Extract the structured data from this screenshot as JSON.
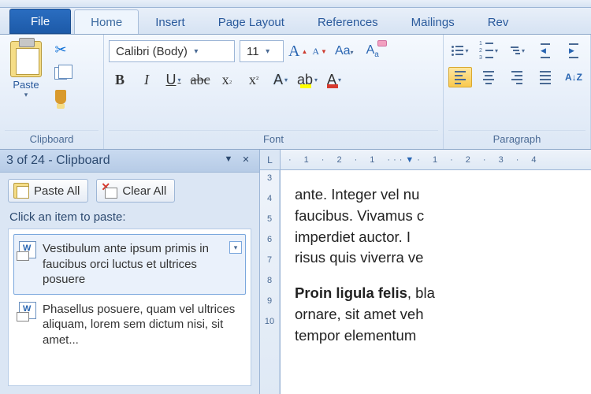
{
  "tabs": {
    "file": "File",
    "home": "Home",
    "insert": "Insert",
    "page_layout": "Page Layout",
    "references": "References",
    "mailings": "Mailings",
    "review": "Rev"
  },
  "ribbon": {
    "clipboard": {
      "label": "Clipboard",
      "paste": "Paste"
    },
    "font": {
      "label": "Font",
      "name": "Calibri (Body)",
      "size": "11",
      "bold": "B",
      "italic": "I",
      "underline": "U",
      "strike": "abc",
      "sub": "x",
      "sup": "x",
      "texteffect": "A",
      "highlight": "ab",
      "fontcolor": "A",
      "grow": "A",
      "shrink": "A",
      "case": "Aa",
      "clear": "A"
    },
    "paragraph": {
      "label": "Paragraph",
      "sort": "A↓Z"
    }
  },
  "clipboard_pane": {
    "title": "3 of 24 - Clipboard",
    "paste_all": "Paste All",
    "clear_all": "Clear All",
    "hint": "Click an item to paste:",
    "items": [
      "Vestibulum ante ipsum primis in faucibus orci luctus et ultrices posuere",
      "Phasellus posuere, quam vel ultrices aliquam, lorem sem dictum nisi, sit amet..."
    ]
  },
  "ruler": {
    "h": [
      "1",
      "2",
      "1",
      "1",
      "2",
      "3",
      "4"
    ],
    "v": [
      "3",
      "4",
      "5",
      "6",
      "7",
      "8",
      "9",
      "10"
    ]
  },
  "document": {
    "p1": "ante. Integer vel nu",
    "p2": "faucibus. Vivamus c",
    "p3": "imperdiet auctor. I",
    "p4": "risus quis viverra ve",
    "p5_bold": "Proin ligula felis",
    "p5_rest": ", bla",
    "p6": "ornare, sit amet veh",
    "p7": "tempor elementum"
  }
}
